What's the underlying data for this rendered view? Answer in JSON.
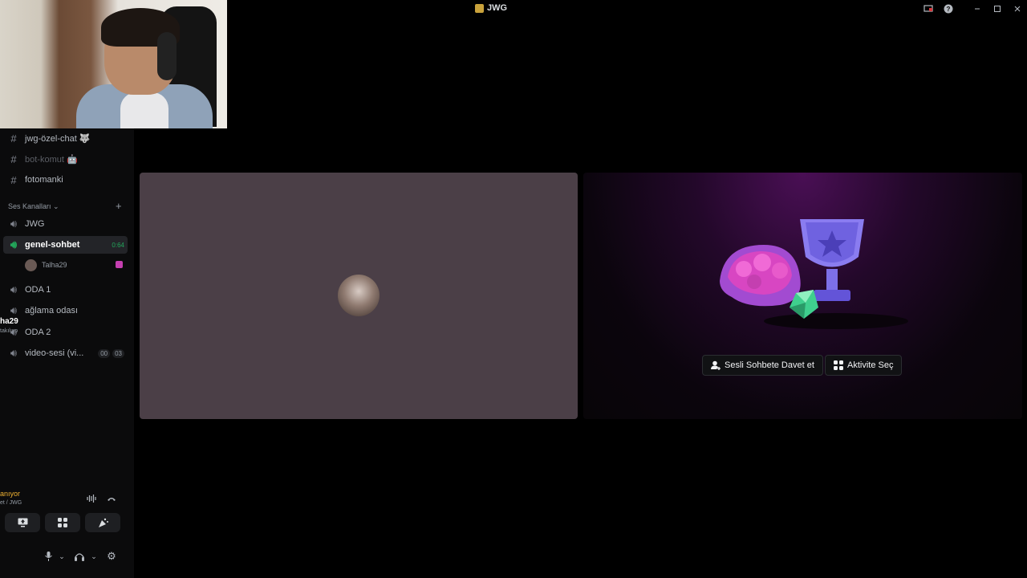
{
  "window": {
    "title": "JWG"
  },
  "titlebar_icons": [
    "monitor-alert-icon",
    "help-icon",
    "minimize-icon",
    "maximize-icon",
    "close-icon"
  ],
  "text_channels": [
    {
      "name": "jwg-özel-chat 🐺",
      "muted": false
    },
    {
      "name": "bot-komut 🤖",
      "muted": true
    },
    {
      "name": "fotomanki",
      "muted": false
    }
  ],
  "voice_section": {
    "label": "Ses Kanalları ⌄",
    "add": "+"
  },
  "voice_channels": [
    {
      "name": "JWG"
    },
    {
      "name": "genel-sohbet",
      "timer": "0:64",
      "active": true
    },
    {
      "name": "ODA 1"
    },
    {
      "name": "ağlama odası"
    },
    {
      "name": "ODA 2"
    },
    {
      "name": "video-sesi (vi...",
      "pills": [
        "00",
        "03"
      ]
    }
  ],
  "voice_user": {
    "name": "Talha29"
  },
  "voice_status": {
    "status": "anıyor",
    "location": "et / JWG"
  },
  "current_user": {
    "name": "ha29",
    "status": "takılıyo"
  },
  "buttons": {
    "invite": "Sesli Sohbete Davet et",
    "activity": "Aktivite Seç"
  },
  "colors": {
    "accent_green": "#23a55a",
    "connecting_yellow": "#f0b232",
    "tile_bg": "#4b3f47",
    "activity_purple": "#4a0f55"
  }
}
